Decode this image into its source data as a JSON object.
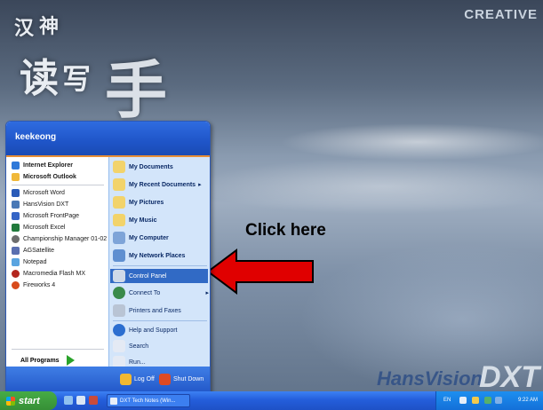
{
  "desktop": {
    "brand_top": "CREATIVE",
    "brand_bottom_left": "HansVision",
    "brand_bottom_right": "DXT",
    "calligraphy_chars": [
      "汉",
      "神",
      "读",
      "写",
      "手"
    ]
  },
  "callout": {
    "text": "Click here",
    "color": "#e00000"
  },
  "start_menu": {
    "user": "keekeong",
    "pinned": [
      {
        "label": "Internet Explorer",
        "icon": "ie-icon"
      },
      {
        "label": "Microsoft Outlook",
        "icon": "outlook-icon"
      }
    ],
    "recent": [
      {
        "label": "Microsoft Word",
        "icon": "word-icon"
      },
      {
        "label": "HansVision DXT",
        "icon": "hansvision-icon"
      },
      {
        "label": "Microsoft FrontPage",
        "icon": "frontpage-icon"
      },
      {
        "label": "Microsoft Excel",
        "icon": "excel-icon"
      },
      {
        "label": "Championship Manager 01-02",
        "icon": "game-icon"
      },
      {
        "label": "AGSatellite",
        "icon": "satellite-icon"
      },
      {
        "label": "Notepad",
        "icon": "notepad-icon"
      },
      {
        "label": "Macromedia Flash MX",
        "icon": "flash-icon"
      },
      {
        "label": "Fireworks 4",
        "icon": "fireworks-icon"
      }
    ],
    "all_programs": "All Programs",
    "right": [
      {
        "label": "My Documents",
        "icon": "folder-icon"
      },
      {
        "label": "My Recent Documents",
        "icon": "recent-docs-icon",
        "arrow": "▸"
      },
      {
        "label": "My Pictures",
        "icon": "pictures-icon"
      },
      {
        "label": "My Music",
        "icon": "music-icon"
      },
      {
        "label": "My Computer",
        "icon": "computer-icon"
      },
      {
        "label": "My Network Places",
        "icon": "network-icon"
      },
      {
        "label": "Control Panel",
        "icon": "control-panel-icon",
        "highlighted": true
      },
      {
        "label": "Connect To",
        "icon": "connect-icon",
        "arrow": "▸"
      },
      {
        "label": "Printers and Faxes",
        "icon": "printer-icon"
      },
      {
        "label": "Help and Support",
        "icon": "help-icon"
      },
      {
        "label": "Search",
        "icon": "search-icon"
      },
      {
        "label": "Run...",
        "icon": "run-icon"
      }
    ],
    "footer": {
      "logoff": "Log Off",
      "shutdown": "Shut Down"
    }
  },
  "taskbar": {
    "start": "start",
    "window_button": "DXT Tech Notes (Win...",
    "tray": {
      "lang": "EN",
      "clock": "9:22 AM"
    }
  }
}
